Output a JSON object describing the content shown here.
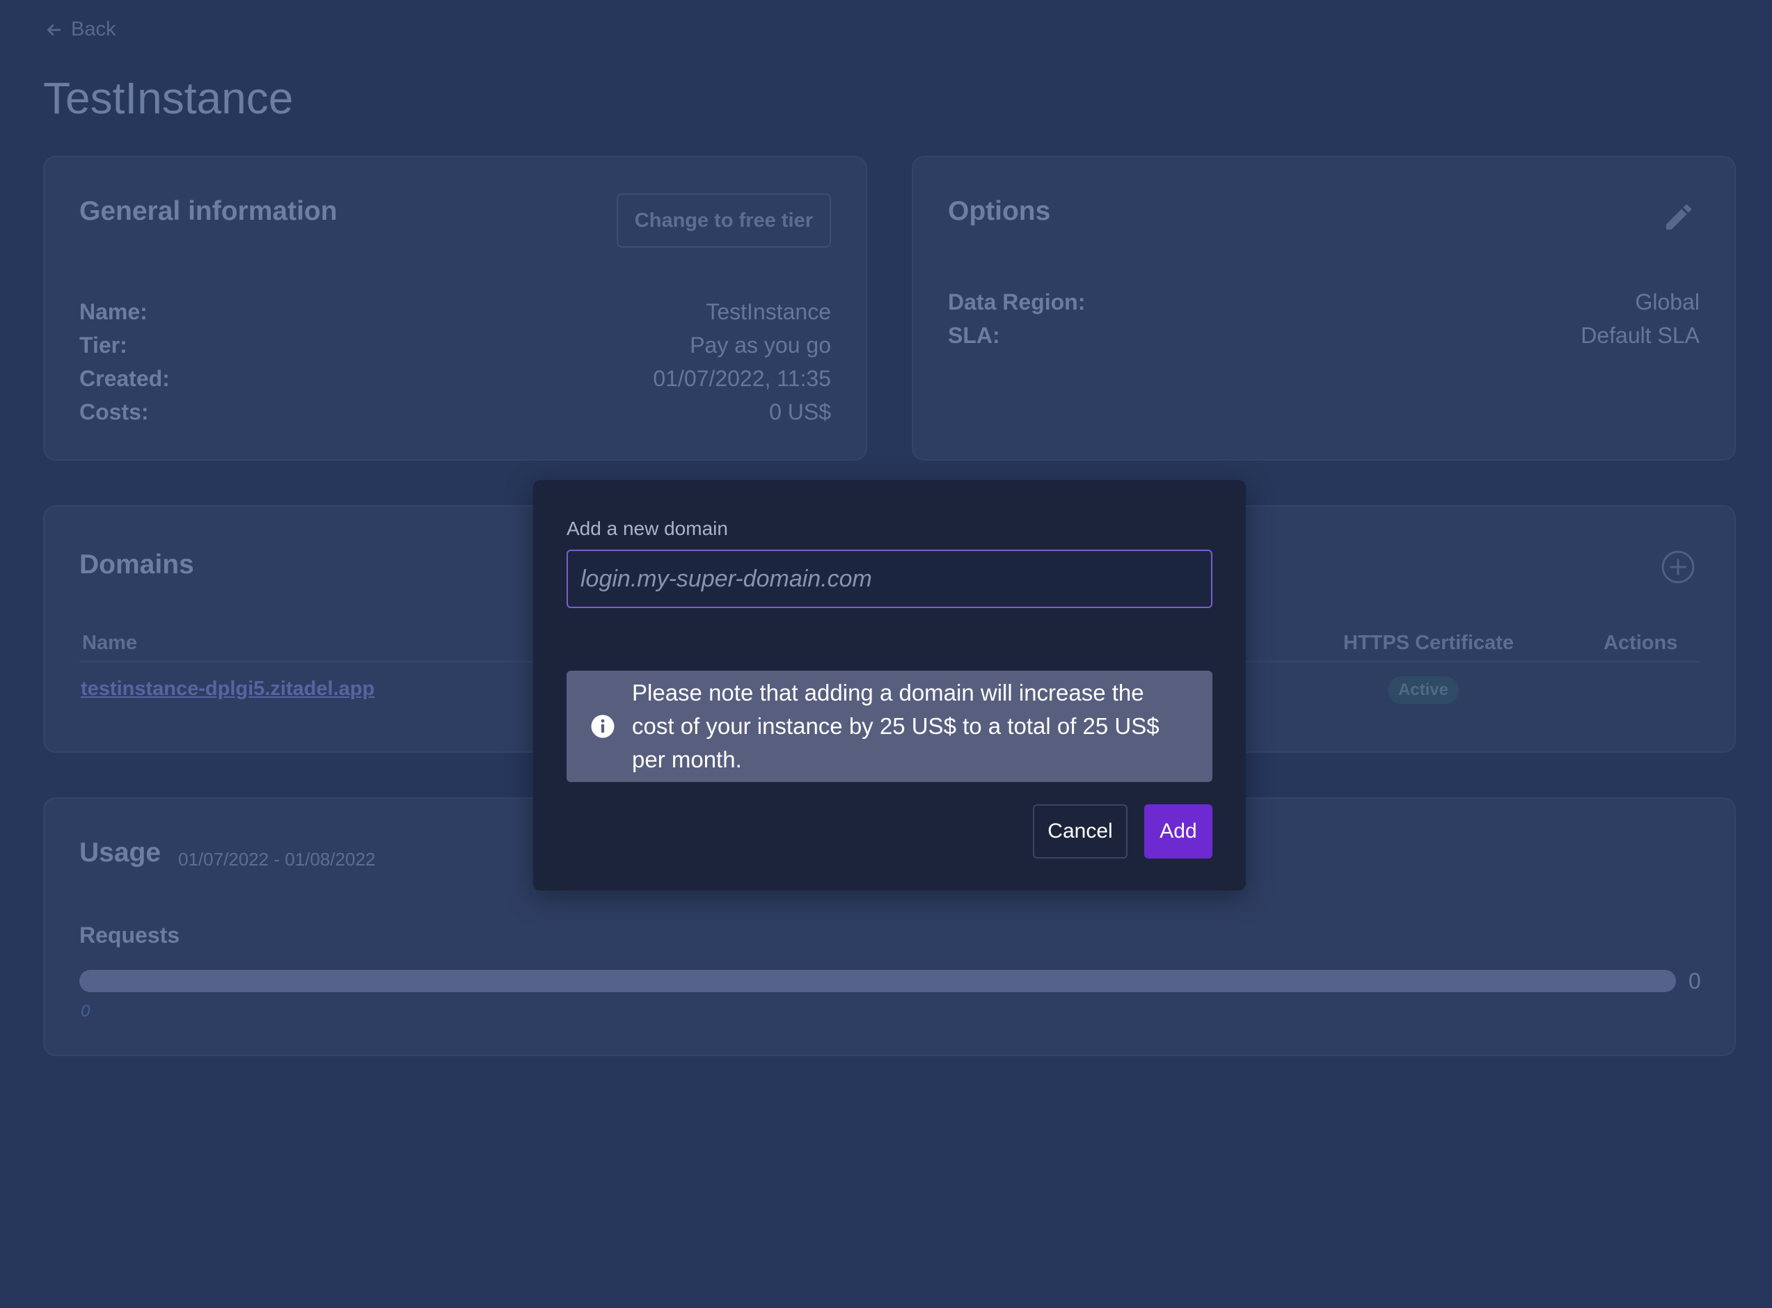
{
  "nav": {
    "back_label": "Back"
  },
  "page": {
    "title": "TestInstance"
  },
  "general": {
    "title": "General information",
    "change_tier_label": "Change to free tier",
    "rows": [
      {
        "key": "Name:",
        "value": "TestInstance"
      },
      {
        "key": "Tier:",
        "value": "Pay as you go"
      },
      {
        "key": "Created:",
        "value": "01/07/2022, 11:35"
      },
      {
        "key": "Costs:",
        "value": "0 US$"
      }
    ]
  },
  "options": {
    "title": "Options",
    "edit_icon": "pencil-icon",
    "rows": [
      {
        "key": "Data Region:",
        "value": "Global"
      },
      {
        "key": "SLA:",
        "value": "Default SLA"
      }
    ]
  },
  "domains": {
    "title": "Domains",
    "add_icon": "plus-circle-icon",
    "columns": {
      "name": "Name",
      "https": "HTTPS Certificate",
      "actions": "Actions"
    },
    "rows": [
      {
        "name": "testinstance-dplgi5.zitadel.app",
        "https_status": "Active"
      }
    ]
  },
  "usage": {
    "title": "Usage",
    "range": "01/07/2022 - 01/08/2022",
    "requests_label": "Requests",
    "requests_value": 0,
    "bar_max_label": "0",
    "bar_min_label": "0",
    "fill_fraction": 0
  },
  "dialog": {
    "label": "Add a new domain",
    "input_placeholder": "login.my-super-domain.com",
    "input_value": "",
    "info_icon": "info-icon",
    "notice": "Please note that adding a domain will increase the cost of your instance by 25 US$ to a total of 25 US$ per month.",
    "cancel_label": "Cancel",
    "add_label": "Add"
  },
  "colors": {
    "background": "#26375b",
    "dialog_bg": "#1c243c",
    "accent": "#6d2ad1",
    "input_border": "#7a5ec9",
    "notice_bg": "#575e7e"
  }
}
